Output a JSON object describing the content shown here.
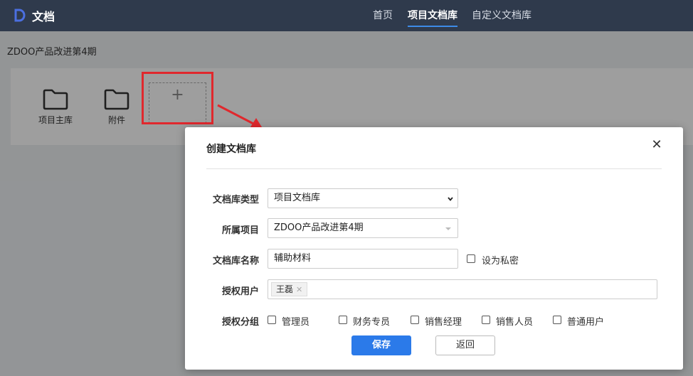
{
  "app": {
    "title": "文档",
    "logo_icon": "d-logo-icon",
    "nav": [
      {
        "label": "首页",
        "active": false
      },
      {
        "label": "项目文档库",
        "active": true
      },
      {
        "label": "自定义文档库",
        "active": false
      }
    ]
  },
  "breadcrumb": "ZDOO产品改进第4期",
  "libraries": [
    {
      "name": "项目主库",
      "icon": "folder-icon"
    },
    {
      "name": "附件",
      "icon": "folder-icon"
    }
  ],
  "add_library": {
    "icon_glyph": "+"
  },
  "annotation": {
    "highlight_color": "#e0282d"
  },
  "dialog": {
    "title": "创建文档库",
    "close_glyph": "✕",
    "fields": {
      "type": {
        "label": "文档库类型",
        "value": "项目文档库"
      },
      "project": {
        "label": "所属项目",
        "value": "ZDOO产品改进第4期"
      },
      "name": {
        "label": "文档库名称",
        "value": "辅助材料"
      },
      "private": {
        "label": "设为私密",
        "checked": false
      },
      "users": {
        "label": "授权用户",
        "tags": [
          "王磊"
        ],
        "remove_glyph": "✕"
      },
      "groups": {
        "label": "授权分组",
        "options": [
          {
            "label": "管理员",
            "checked": false
          },
          {
            "label": "财务专员",
            "checked": false
          },
          {
            "label": "销售经理",
            "checked": false
          },
          {
            "label": "销售人员",
            "checked": false
          },
          {
            "label": "普通用户",
            "checked": false
          }
        ]
      }
    },
    "save_label": "保存",
    "back_label": "返回"
  },
  "colors": {
    "topbar": "#2f3a4c",
    "primary": "#2b7ae9",
    "nav_active_underline": "#3d8be8"
  }
}
